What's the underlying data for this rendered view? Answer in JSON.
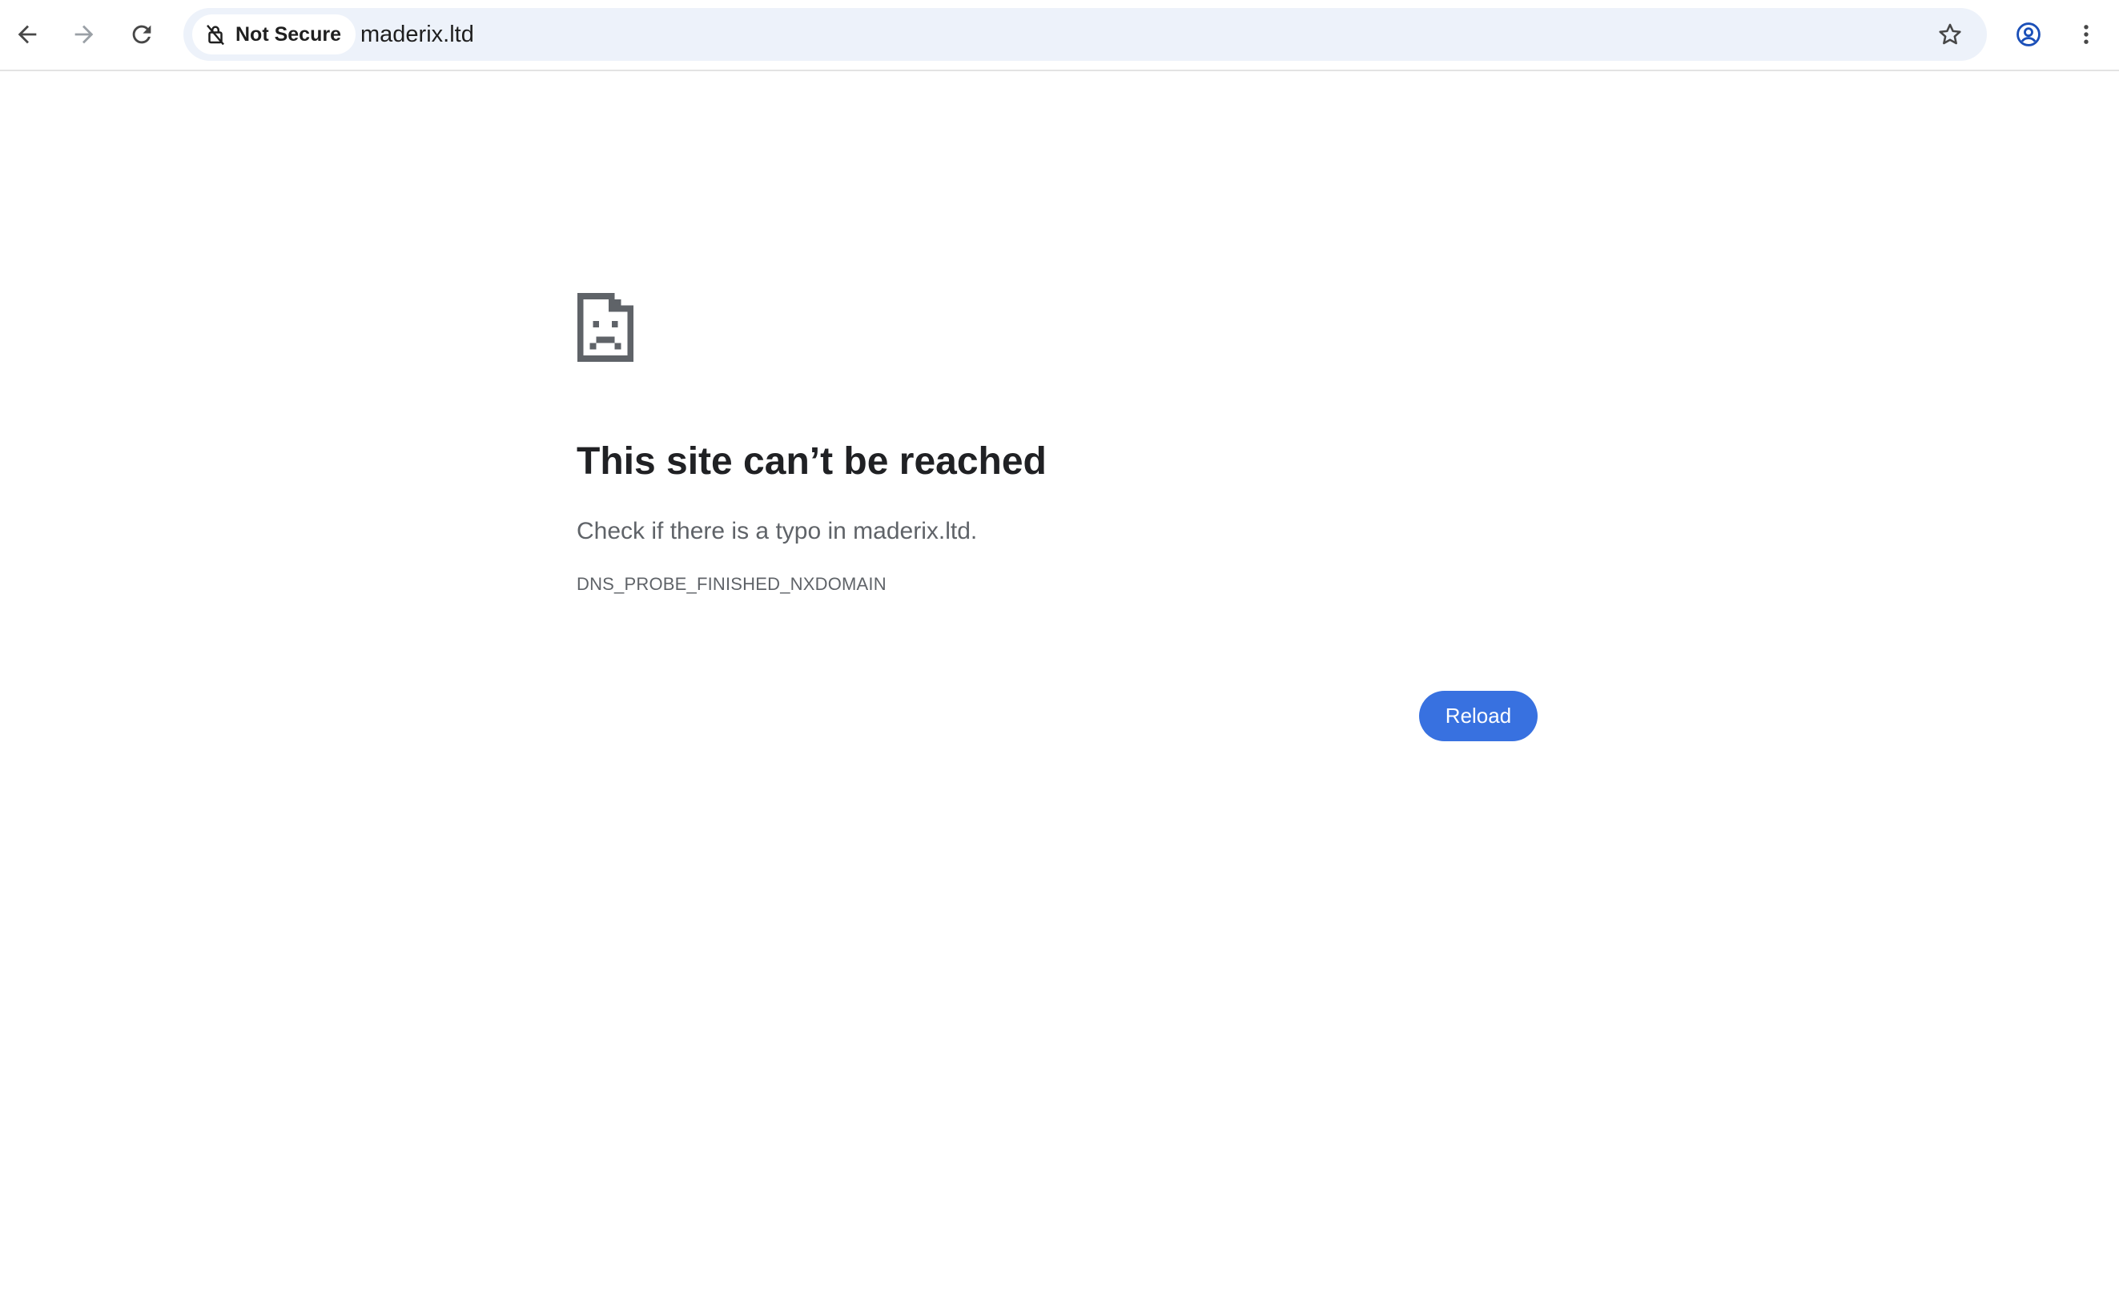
{
  "browser": {
    "nav": {
      "back_icon": "arrow-left-icon",
      "forward_icon": "arrow-right-icon",
      "reload_icon": "reload-icon"
    },
    "omnibox": {
      "security_label": "Not Secure",
      "security_icon": "not-secure-lock-icon",
      "url": "maderix.ltd",
      "bookmark_icon": "star-icon"
    },
    "profile_icon": "profile-icon",
    "menu_icon": "kebab-menu-icon"
  },
  "error_page": {
    "icon": "sad-document-icon",
    "title": "This site can’t be reached",
    "suggestion": "Check if there is a typo in maderix.ltd.",
    "error_code": "DNS_PROBE_FINISHED_NXDOMAIN",
    "reload_label": "Reload"
  },
  "colors": {
    "accent": "#3871e0",
    "omnibox_bg": "#edf2fa",
    "heading_text": "#202124",
    "secondary_text": "#5f6368",
    "profile_icon": "#1a4fb8"
  }
}
